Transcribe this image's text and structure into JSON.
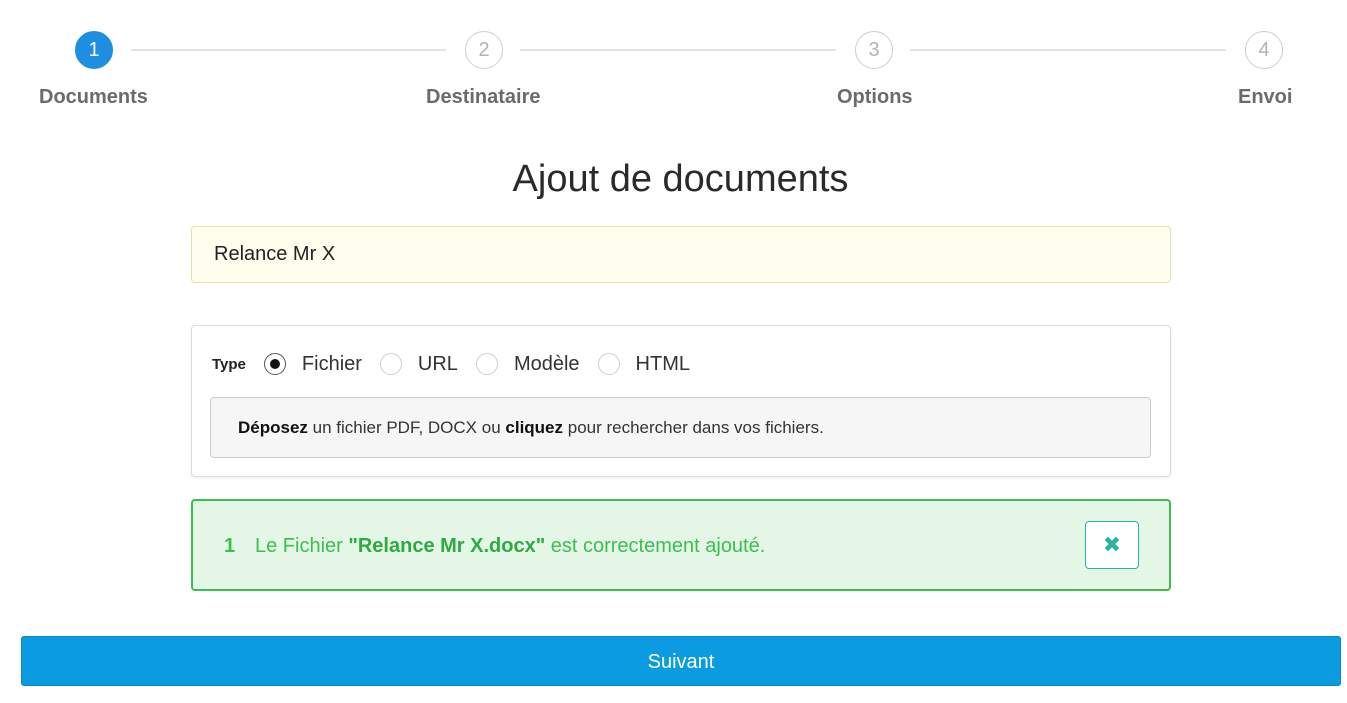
{
  "stepper": {
    "steps": [
      {
        "number": "1",
        "label": "Documents",
        "active": true
      },
      {
        "number": "2",
        "label": "Destinataire",
        "active": false
      },
      {
        "number": "3",
        "label": "Options",
        "active": false
      },
      {
        "number": "4",
        "label": "Envoi",
        "active": false
      }
    ],
    "active_color": "#1e8fe0"
  },
  "page": {
    "title": "Ajout de documents"
  },
  "document": {
    "name_value": "Relance Mr X"
  },
  "type_selector": {
    "label": "Type",
    "options": [
      {
        "label": "Fichier",
        "checked": true
      },
      {
        "label": "URL",
        "checked": false
      },
      {
        "label": "Modèle",
        "checked": false
      },
      {
        "label": "HTML",
        "checked": false
      }
    ]
  },
  "dropzone": {
    "drop_word": "Déposez",
    "middle_text": " un fichier PDF, DOCX ou ",
    "click_word": "cliquez",
    "end_text": " pour rechercher dans vos fichiers."
  },
  "alert": {
    "count": "1",
    "prefix": "Le Fichier ",
    "filename": "\"Relance Mr X.docx\"",
    "suffix": " est correctement ajouté.",
    "close_icon": "close-x-icon",
    "close_glyph": "✖",
    "color": "#3cbf4e"
  },
  "footer": {
    "next_label": "Suivant",
    "button_color": "#0b9be0"
  }
}
